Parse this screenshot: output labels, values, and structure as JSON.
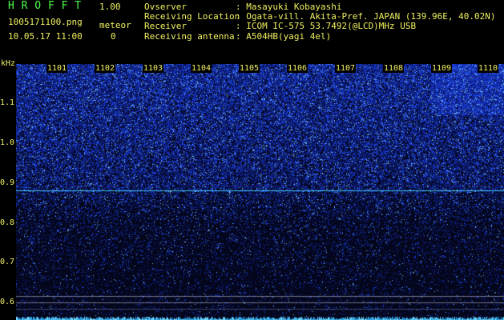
{
  "header": {
    "app_title": "H R O F F T",
    "version": "1.00",
    "filename": "1005171100.png",
    "datetime": "10.05.17 11:00",
    "meteor_label": "meteor",
    "meteor_count": "0"
  },
  "info": [
    {
      "key": "Ovserver",
      "value": ": Masayuki Kobayashi"
    },
    {
      "key": "Receiving Location",
      "value": ": Ogata-vill. Akita-Pref. JAPAN (139.96E, 40.02N)"
    },
    {
      "key": "Receiver",
      "value": ": ICOM IC-575 53.7492(@LCD)MHz USB"
    },
    {
      "key": "Receiving antenna",
      "value": ": A504HB(yagi 4el)"
    }
  ],
  "axis": {
    "y_unit": "kHz",
    "y_ticks": [
      "1.1",
      "1.0",
      "0.9",
      "0.8",
      "0.7",
      "0.6"
    ],
    "x_ticks": [
      "1101",
      "1102",
      "1103",
      "1104",
      "1105",
      "1106",
      "1107",
      "1108",
      "1109",
      "1110"
    ]
  },
  "colors": {
    "text": "#f0f060",
    "title": "#4cff4c",
    "signal_line": "#40c8ff"
  }
}
